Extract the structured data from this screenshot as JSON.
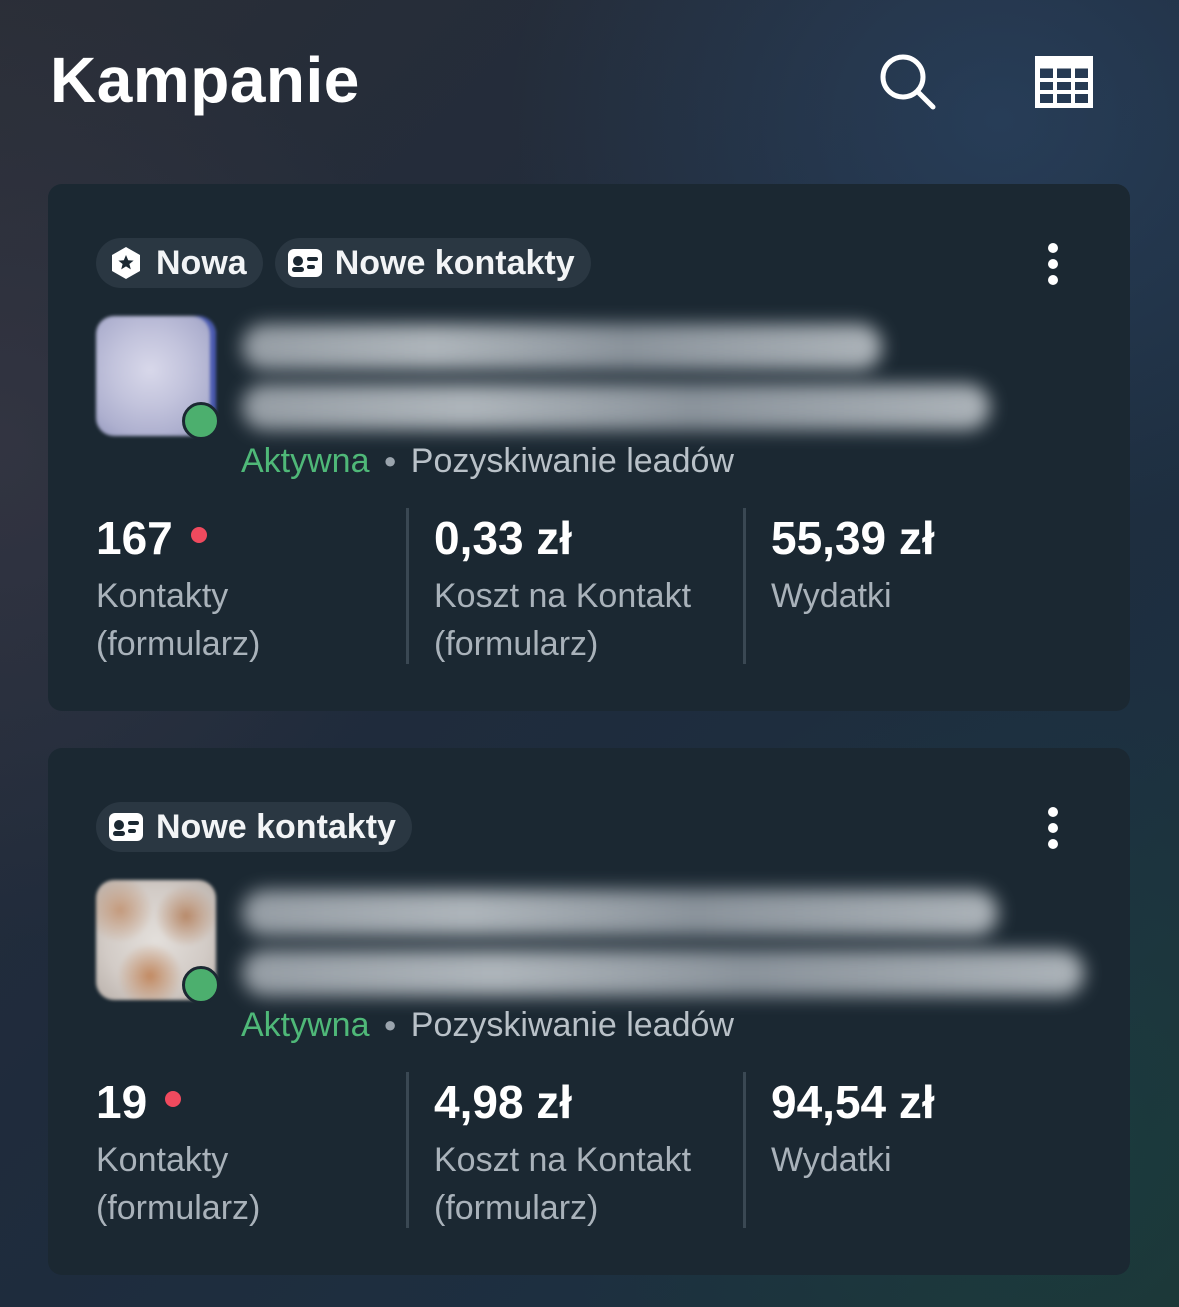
{
  "header": {
    "title": "Kampanie",
    "search_icon": "search-icon",
    "table_icon": "table-icon"
  },
  "campaigns": [
    {
      "tags": [
        {
          "icon": "badge-new-icon",
          "label": "Nowa"
        },
        {
          "icon": "contact-card-icon",
          "label": "Nowe kontakty"
        }
      ],
      "status": "Aktywna",
      "objective": "Pozyskiwanie leadów",
      "metrics": [
        {
          "value": "167",
          "label_line1": "Kontakty",
          "label_line2": "(formularz)"
        },
        {
          "value": "0,33 zł",
          "label_line1": "Koszt na Kontakt",
          "label_line2": "(formularz)"
        },
        {
          "value": "55,39 zł",
          "label_line1": "Wydatki",
          "label_line2": ""
        }
      ]
    },
    {
      "tags": [
        {
          "icon": "contact-card-icon",
          "label": "Nowe kontakty"
        }
      ],
      "status": "Aktywna",
      "objective": "Pozyskiwanie leadów",
      "metrics": [
        {
          "value": "19",
          "label_line1": "Kontakty",
          "label_line2": "(formularz)"
        },
        {
          "value": "4,98 zł",
          "label_line1": "Koszt na Kontakt",
          "label_line2": "(formularz)"
        },
        {
          "value": "94,54 zł",
          "label_line1": "Wydatki",
          "label_line2": ""
        }
      ]
    }
  ],
  "colors": {
    "active": "#4fb878",
    "alert": "#f04a5e",
    "card": "#1b2832"
  }
}
